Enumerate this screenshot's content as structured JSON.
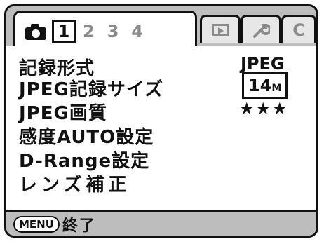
{
  "tabs": {
    "camera_icon": "camera-icon",
    "pages": [
      "1",
      "2",
      "3",
      "4"
    ],
    "active_page": "1",
    "playback_icon": "playback-icon",
    "setup_icon": "wrench-icon",
    "custom_label": "C"
  },
  "menu": {
    "items": [
      {
        "label": "記録形式",
        "value": "JPEG"
      },
      {
        "label": "JPEG記録サイズ",
        "value": "14",
        "value_suffix": "M"
      },
      {
        "label": "JPEG画質",
        "value": "★★★"
      },
      {
        "label": "感度AUTO設定",
        "value": ""
      },
      {
        "label": "D-Range設定",
        "value": ""
      },
      {
        "label": "レンズ補正",
        "value": ""
      }
    ]
  },
  "footer": {
    "menu_button": "MENU",
    "action_label": "終了"
  }
}
